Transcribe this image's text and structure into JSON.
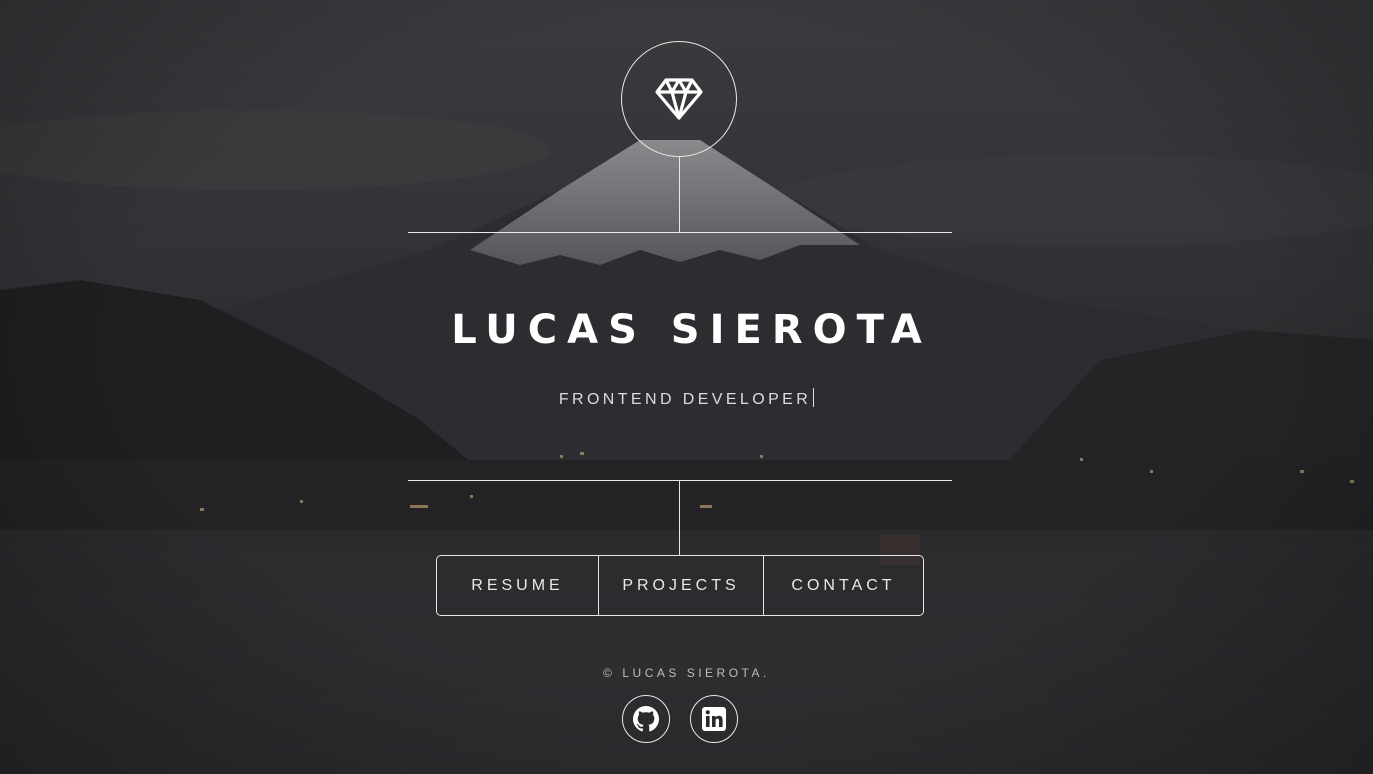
{
  "header": {
    "logo_icon": "diamond-icon",
    "name": "LUCAS SIEROTA",
    "role": "FRONTEND DEVELOPER"
  },
  "nav": {
    "items": [
      {
        "label": "RESUME"
      },
      {
        "label": "PROJECTS"
      },
      {
        "label": "CONTACT"
      }
    ]
  },
  "footer": {
    "copyright": "© LUCAS SIEROTA.",
    "social": [
      {
        "icon": "github-icon"
      },
      {
        "icon": "linkedin-icon"
      }
    ]
  },
  "colors": {
    "line": "#e8e8e8",
    "text": "#ffffff",
    "background_overlay": "#1f1f22"
  }
}
